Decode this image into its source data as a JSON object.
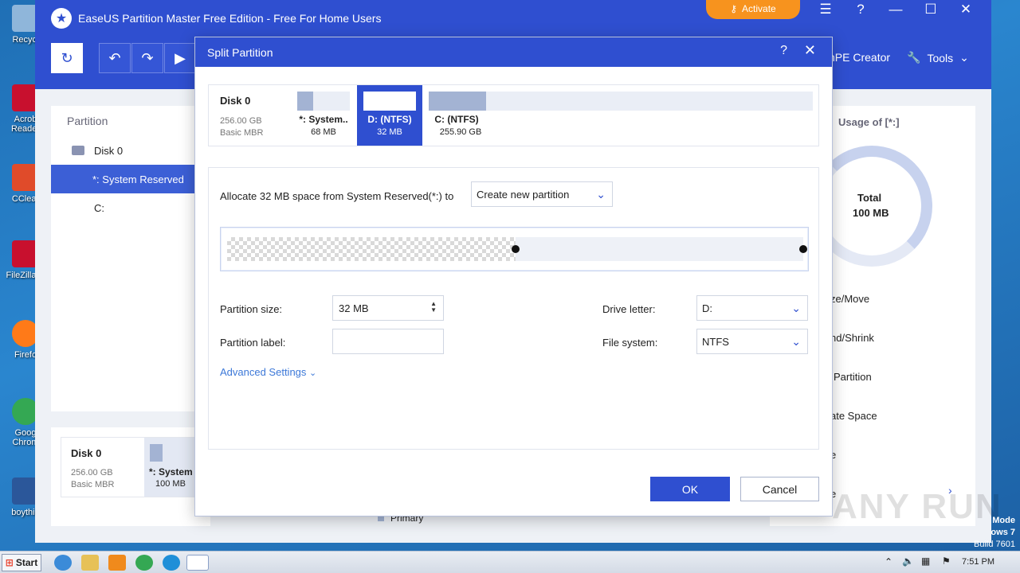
{
  "desktop": {
    "icons": [
      {
        "label": "Recycl",
        "color": "#8fb6da"
      },
      {
        "label": "Acrob Reader",
        "color": "#c8102e"
      },
      {
        "label": "CClear",
        "color": "#e04b2a"
      },
      {
        "label": "FileZilla C",
        "color": "#c8102e"
      },
      {
        "label": "Firefo",
        "color": "#ff7a18"
      },
      {
        "label": "Goog Chrom",
        "color": "#34a853"
      },
      {
        "label": "boythin",
        "color": "#2b579a"
      }
    ]
  },
  "app": {
    "title": "EaseUS Partition Master Free Edition - Free For Home Users",
    "activate_label": "Activate",
    "toolbar": {
      "winpe_label": "nPE Creator",
      "tools_label": "Tools"
    },
    "left_panel": {
      "header": "Partition",
      "items": [
        "Disk 0",
        "*: System Reserved",
        "C:"
      ]
    },
    "disk_map": {
      "name": "Disk 0",
      "size": "256.00 GB",
      "type": "Basic MBR",
      "part_name": "*: System",
      "part_size": "100 MB",
      "legend": "Primary"
    },
    "right_panel": {
      "usage_title": "Usage of [*:]",
      "total_label": "Total",
      "total_value": "100 MB",
      "actions": [
        "ze/Move",
        "nd/Shrink",
        "Partition",
        "ate Space",
        "e",
        "e"
      ]
    }
  },
  "dialog": {
    "title": "Split Partition",
    "disk": {
      "name": "Disk 0",
      "size": "256.00 GB",
      "type": "Basic MBR",
      "partitions": [
        {
          "name": "*: System..",
          "size": "68 MB",
          "fill": 0.3
        },
        {
          "name": "D: (NTFS)",
          "size": "32 MB",
          "fill": 0.0
        },
        {
          "name": "C: (NTFS)",
          "size": "255.90 GB",
          "fill": 0.15
        }
      ]
    },
    "allocate_text": "Allocate 32 MB space from System Reserved(*:) to",
    "allocate_option": "Create new partition",
    "slider_used_fraction": 0.5,
    "partition_size_label": "Partition size:",
    "partition_size_value": "32 MB",
    "partition_label_label": "Partition label:",
    "partition_label_value": "",
    "drive_letter_label": "Drive letter:",
    "drive_letter_value": "D:",
    "file_system_label": "File system:",
    "file_system_value": "NTFS",
    "advanced_label": "Advanced Settings",
    "ok_label": "OK",
    "cancel_label": "Cancel"
  },
  "taskbar": {
    "start_label": "Start",
    "clock": "7:51 PM"
  },
  "os_text": {
    "mode": "Mode",
    "windows": "ows 7",
    "build": "Build 7601"
  },
  "watermark": "ANY RUN"
}
